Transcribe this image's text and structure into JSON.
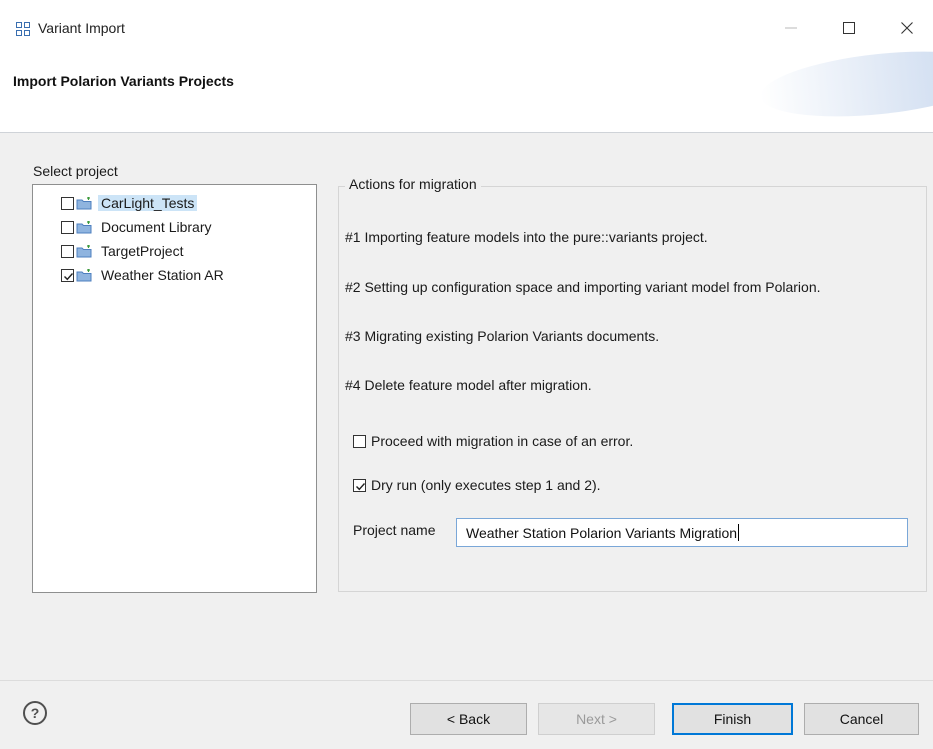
{
  "window": {
    "title": "Variant Import",
    "app_icon": "grid-icon",
    "controls": {
      "minimize": "—",
      "maximize": "☐",
      "close": "✕"
    }
  },
  "header": {
    "title": "Import Polarion Variants Projects"
  },
  "projects": {
    "label": "Select project",
    "items": [
      {
        "label": "CarLight_Tests",
        "checked": false,
        "selected": true
      },
      {
        "label": "Document Library",
        "checked": false,
        "selected": false
      },
      {
        "label": "TargetProject",
        "checked": false,
        "selected": false
      },
      {
        "label": "Weather Station AR",
        "checked": true,
        "selected": false
      }
    ]
  },
  "actions": {
    "title": "Actions for migration",
    "steps": [
      "#1 Importing feature models into the pure::variants project.",
      "#2 Setting up configuration space and importing variant model from Polarion.",
      "#3 Migrating existing Polarion Variants documents.",
      "#4 Delete feature model after migration."
    ],
    "options": [
      {
        "label": "Proceed with migration in case of an error.",
        "checked": false
      },
      {
        "label": "Dry run (only executes step 1 and 2).",
        "checked": true
      }
    ],
    "project_name_label": "Project name",
    "project_name_value": "Weather Station Polarion Variants Migration"
  },
  "footer": {
    "help": "?",
    "back": "< Back",
    "next": "Next >",
    "finish": "Finish",
    "cancel": "Cancel"
  },
  "colors": {
    "accent": "#0078d7",
    "selection": "#cce4f7",
    "dialog_bg": "#f0f0f0"
  }
}
